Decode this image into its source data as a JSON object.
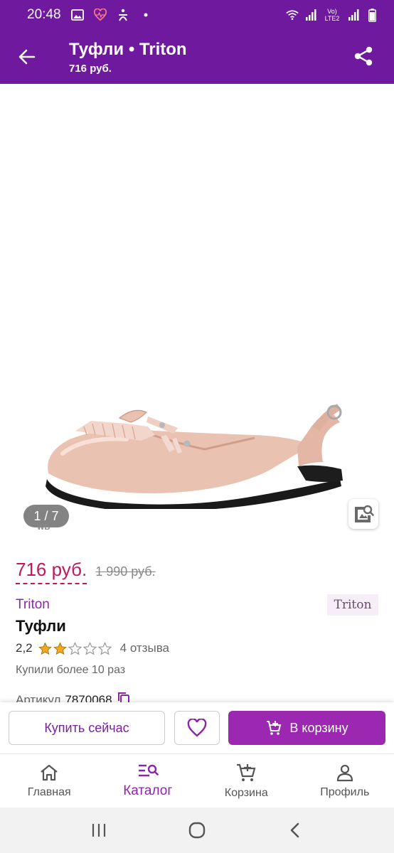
{
  "status_bar": {
    "time": "20:48",
    "network": "Vo) LTE2",
    "icons": [
      "gallery-icon",
      "health-icon",
      "accessibility-icon",
      "dot-icon",
      "wifi-icon",
      "signal-icon",
      "battery-icon"
    ]
  },
  "header": {
    "title": "Туфли • Triton",
    "subtitle": "716 руб."
  },
  "gallery": {
    "counter": "1 / 7",
    "watermark": "WB"
  },
  "product": {
    "price": "716 руб.",
    "old_price": "1 990 руб.",
    "brand": "Triton",
    "brand_logo": "Triton",
    "name": "Туфли",
    "rating": "2,2",
    "rating_value": 2.2,
    "stars_total": 5,
    "reviews": "4 отзыва",
    "bought": "Купили более 10 раз",
    "article_label": "Артикул",
    "article_value": "7870068"
  },
  "actions": {
    "buy_now": "Купить сейчас",
    "add_to_cart": "В корзину"
  },
  "bottom_nav": {
    "items": [
      {
        "label": "Главная",
        "icon": "home-icon"
      },
      {
        "label": "Каталог",
        "icon": "catalog-search-icon"
      },
      {
        "label": "Корзина",
        "icon": "cart-icon"
      },
      {
        "label": "Профиль",
        "icon": "profile-icon"
      }
    ],
    "active_index": 1
  },
  "colors": {
    "brand_purple": "#6f1a9e",
    "accent_purple": "#9c27b0",
    "price_pink": "#c2185b",
    "star_gold": "#f5a623"
  }
}
